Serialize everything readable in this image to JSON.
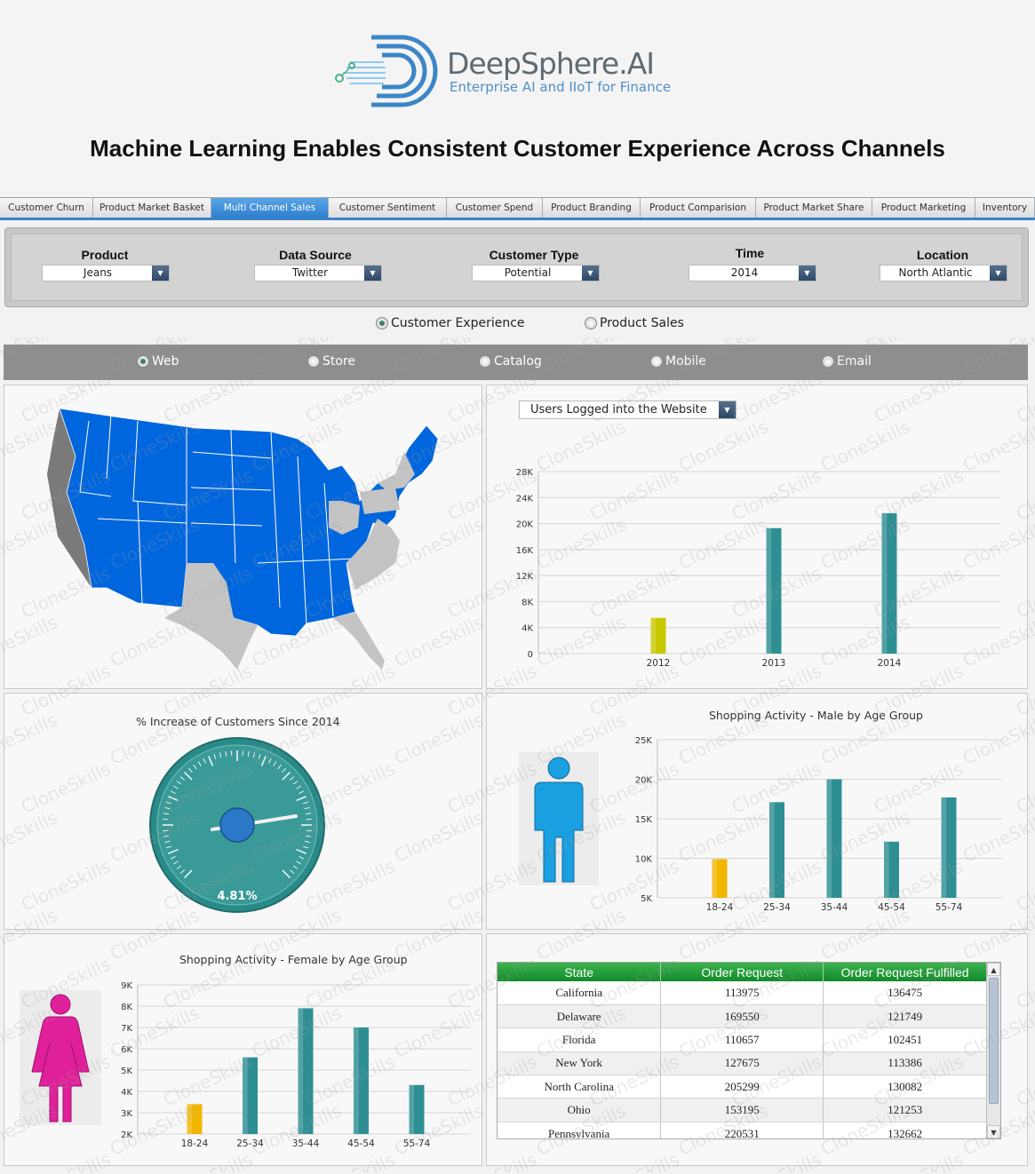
{
  "brand": {
    "name": "DeepSphere.AI",
    "tagline": "Enterprise AI and IIoT for Finance"
  },
  "page_title": "Machine Learning Enables Consistent Customer Experience Across Channels",
  "tabs": [
    {
      "label": "Customer Churn",
      "active": false
    },
    {
      "label": "Product Market Basket",
      "active": false
    },
    {
      "label": "Multi Channel Sales",
      "active": true
    },
    {
      "label": "Customer Sentiment",
      "active": false
    },
    {
      "label": "Customer Spend",
      "active": false
    },
    {
      "label": "Product Branding",
      "active": false
    },
    {
      "label": "Product Comparision",
      "active": false
    },
    {
      "label": "Product Market Share",
      "active": false
    },
    {
      "label": "Product Marketing",
      "active": false
    },
    {
      "label": "Inventory",
      "active": false
    }
  ],
  "filters": {
    "product": {
      "label": "Product",
      "value": "Jeans"
    },
    "data_source": {
      "label": "Data Source",
      "value": "Twitter"
    },
    "customer_type": {
      "label": "Customer Type",
      "value": "Potential"
    },
    "time": {
      "label": "Time",
      "value": "2014"
    },
    "location": {
      "label": "Location",
      "value": "North Atlantic"
    }
  },
  "view_mode": {
    "options": [
      "Customer Experience",
      "Product Sales"
    ],
    "selected": "Customer Experience"
  },
  "channels": {
    "options": [
      "Web",
      "Store",
      "Catalog",
      "Mobile",
      "Email"
    ],
    "selected": "Web"
  },
  "metric_dropdown": {
    "value": "Users Logged into the Website"
  },
  "map": {
    "highlight_color": "#0066dd",
    "secondary_color": "#c4c4c4",
    "dark_color": "#7a7a7a"
  },
  "gauge": {
    "title": "% Increase of Customers Since 2014",
    "value_label": "4.81%",
    "value": 4.81,
    "color": "#3a9a98"
  },
  "watermark_text": "CloneSkills",
  "chart_data": [
    {
      "id": "users-logged",
      "type": "bar",
      "title": "",
      "categories": [
        "2012",
        "2013",
        "2014"
      ],
      "values": [
        5500,
        19300,
        21600
      ],
      "colors": [
        "#c8c800",
        "#2e8f93",
        "#2e8f93"
      ],
      "ylim": [
        0,
        28000
      ],
      "yticks": [
        "0",
        "4K",
        "8K",
        "12K",
        "16K",
        "20K",
        "24K",
        "28K"
      ]
    },
    {
      "id": "male-activity",
      "type": "bar",
      "title": "Shopping Activity - Male by Age Group",
      "categories": [
        "18-24",
        "25-34",
        "35-44",
        "45-54",
        "55-74"
      ],
      "values": [
        9900,
        17100,
        20000,
        12100,
        17700
      ],
      "colors": [
        "#f2b600",
        "#2e8f93",
        "#2e8f93",
        "#2e8f93",
        "#2e8f93"
      ],
      "ylim": [
        5000,
        25000
      ],
      "yticks": [
        "5K",
        "10K",
        "15K",
        "20K",
        "25K"
      ]
    },
    {
      "id": "female-activity",
      "type": "bar",
      "title": "Shopping Activity - Female by Age Group",
      "categories": [
        "18-24",
        "25-34",
        "35-44",
        "45-54",
        "55-74"
      ],
      "values": [
        3400,
        5600,
        7900,
        7000,
        4300
      ],
      "colors": [
        "#f2b600",
        "#2e8f93",
        "#2e8f93",
        "#2e8f93",
        "#2e8f93"
      ],
      "ylim": [
        2000,
        9000
      ],
      "yticks": [
        "2K",
        "3K",
        "4K",
        "5K",
        "6K",
        "7K",
        "8K",
        "9K"
      ]
    }
  ],
  "orders_table": {
    "columns": [
      "State",
      "Order Request",
      "Order Request Fulfilled"
    ],
    "rows": [
      [
        "California",
        "113975",
        "136475"
      ],
      [
        "Delaware",
        "169550",
        "121749"
      ],
      [
        "Florida",
        "110657",
        "102451"
      ],
      [
        "New York",
        "127675",
        "113386"
      ],
      [
        "North Carolina",
        "205299",
        "130082"
      ],
      [
        "Ohio",
        "153195",
        "121253"
      ],
      [
        "Pennsylvania",
        "220531",
        "132662"
      ]
    ]
  }
}
